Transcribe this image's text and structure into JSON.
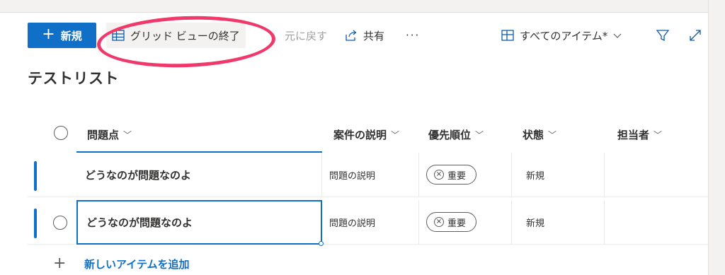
{
  "toolbar": {
    "new_label": "新規",
    "grid_view_exit_label": "グリッド ビューの終了",
    "undo_label": "元に戻す",
    "share_label": "共有",
    "more_label": "···",
    "view_selector_label": "すべてのアイテム*"
  },
  "list_title": "テストリスト",
  "columns": {
    "issue": "問題点",
    "description": "案件の説明",
    "priority": "優先順位",
    "status": "状態",
    "assignee": "担当者"
  },
  "rows": [
    {
      "issue": "どうなのが問題なのよ",
      "description": "問題の説明",
      "priority": "重要",
      "status": "新規",
      "assignee": ""
    },
    {
      "issue": "どうなのが問題なのよ",
      "description": "問題の説明",
      "priority": "重要",
      "status": "新規",
      "assignee": ""
    }
  ],
  "add_item_label": "新しいアイテムを追加",
  "colors": {
    "accent": "#1070c7",
    "highlight": "#f0396a"
  }
}
